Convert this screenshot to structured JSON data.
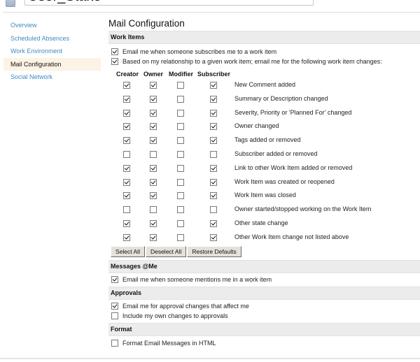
{
  "header": {
    "user_name": "User_Stake"
  },
  "sidebar": {
    "items": [
      {
        "label": "Overview",
        "active": false
      },
      {
        "label": "Scheduled Absences",
        "active": false
      },
      {
        "label": "Work Environment",
        "active": false
      },
      {
        "label": "Mail Configuration",
        "active": true
      },
      {
        "label": "Social Network",
        "active": false
      }
    ]
  },
  "main": {
    "title": "Mail Configuration",
    "work_items": {
      "heading": "Work Items",
      "options": [
        {
          "label": "Email me when someone subscribes me to a work item",
          "checked": true
        },
        {
          "label": "Based on my relationship to a given work item; email me for the following work item changes:",
          "checked": true
        }
      ],
      "columns": [
        "Creator",
        "Owner",
        "Modifier",
        "Subscriber"
      ],
      "rows": [
        {
          "label": "New Comment added",
          "values": [
            true,
            true,
            false,
            true
          ]
        },
        {
          "label": "Summary or Description changed",
          "values": [
            true,
            true,
            false,
            true
          ]
        },
        {
          "label": "Severity, Priority or 'Planned For' changed",
          "values": [
            true,
            true,
            false,
            true
          ]
        },
        {
          "label": "Owner changed",
          "values": [
            true,
            true,
            false,
            true
          ]
        },
        {
          "label": "Tags added or removed",
          "values": [
            true,
            true,
            false,
            true
          ]
        },
        {
          "label": "Subscriber added or removed",
          "values": [
            false,
            false,
            false,
            false
          ]
        },
        {
          "label": "Link to other Work Item added or removed",
          "values": [
            true,
            true,
            false,
            true
          ]
        },
        {
          "label": "Work Item was created or reopened",
          "values": [
            true,
            true,
            false,
            true
          ]
        },
        {
          "label": "Work Item was closed",
          "values": [
            true,
            true,
            false,
            true
          ]
        },
        {
          "label": "Owner started/stopped working on the Work Item",
          "values": [
            false,
            false,
            false,
            false
          ]
        },
        {
          "label": "Other state change",
          "values": [
            true,
            true,
            false,
            true
          ]
        },
        {
          "label": "Other Work Item change not listed above",
          "values": [
            true,
            true,
            false,
            true
          ]
        }
      ],
      "buttons": {
        "select_all": "Select All",
        "deselect_all": "Deselect All",
        "restore_defaults": "Restore Defaults"
      }
    },
    "messages": {
      "heading": "Messages @Me",
      "options": [
        {
          "label": "Email me when someone mentions me in a work item",
          "checked": true
        }
      ]
    },
    "approvals": {
      "heading": "Approvals",
      "options": [
        {
          "label": "Email me for approval changes that affect me",
          "checked": true
        },
        {
          "label": "Include my own changes to approvals",
          "checked": false
        }
      ]
    },
    "format": {
      "heading": "Format",
      "options": [
        {
          "label": "Format Email Messages in HTML",
          "checked": false
        }
      ]
    }
  }
}
